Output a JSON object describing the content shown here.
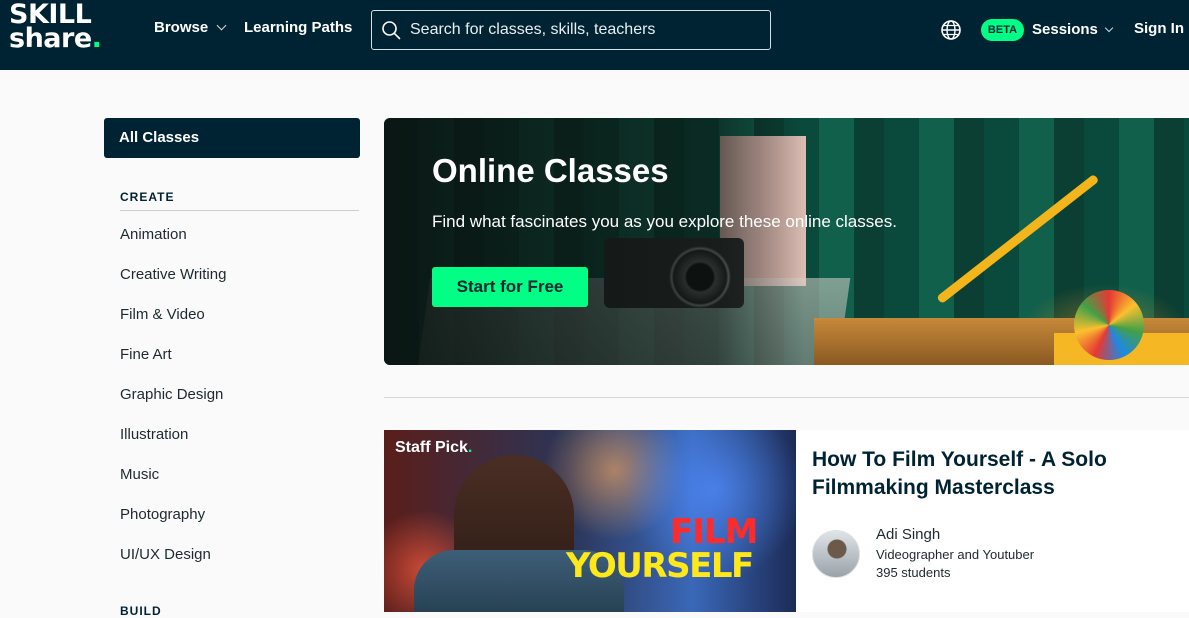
{
  "header": {
    "logo_line1": "SKILL",
    "logo_line2": "share",
    "logo_dot": ".",
    "browse_label": "Browse",
    "learning_paths_label": "Learning Paths",
    "search_placeholder": "Search for classes, skills, teachers",
    "beta_badge": "BETA",
    "sessions_label": "Sessions",
    "sign_in_label": "Sign In"
  },
  "sidebar": {
    "all_classes_label": "All Classes",
    "section_heading": "CREATE",
    "items": [
      {
        "label": "Animation"
      },
      {
        "label": "Creative Writing"
      },
      {
        "label": "Film & Video"
      },
      {
        "label": "Fine Art"
      },
      {
        "label": "Graphic Design"
      },
      {
        "label": "Illustration"
      },
      {
        "label": "Music"
      },
      {
        "label": "Photography"
      },
      {
        "label": "UI/UX Design"
      }
    ],
    "next_section_heading": "BUILD"
  },
  "hero": {
    "title": "Online Classes",
    "subtitle": "Find what fascinates you as you explore these online classes.",
    "cta_label": "Start for Free"
  },
  "featured_class": {
    "badge": "Staff Pick",
    "badge_dot": ".",
    "thumb_word1": "FILM",
    "thumb_word2": "YOURSELF",
    "title": "How To Film Yourself - A Solo Filmmaking Masterclass",
    "teacher_name": "Adi Singh",
    "teacher_role": "Videographer and Youtuber",
    "students": "395 students"
  },
  "colors": {
    "navy": "#002333",
    "brand_green": "#00ff84"
  }
}
